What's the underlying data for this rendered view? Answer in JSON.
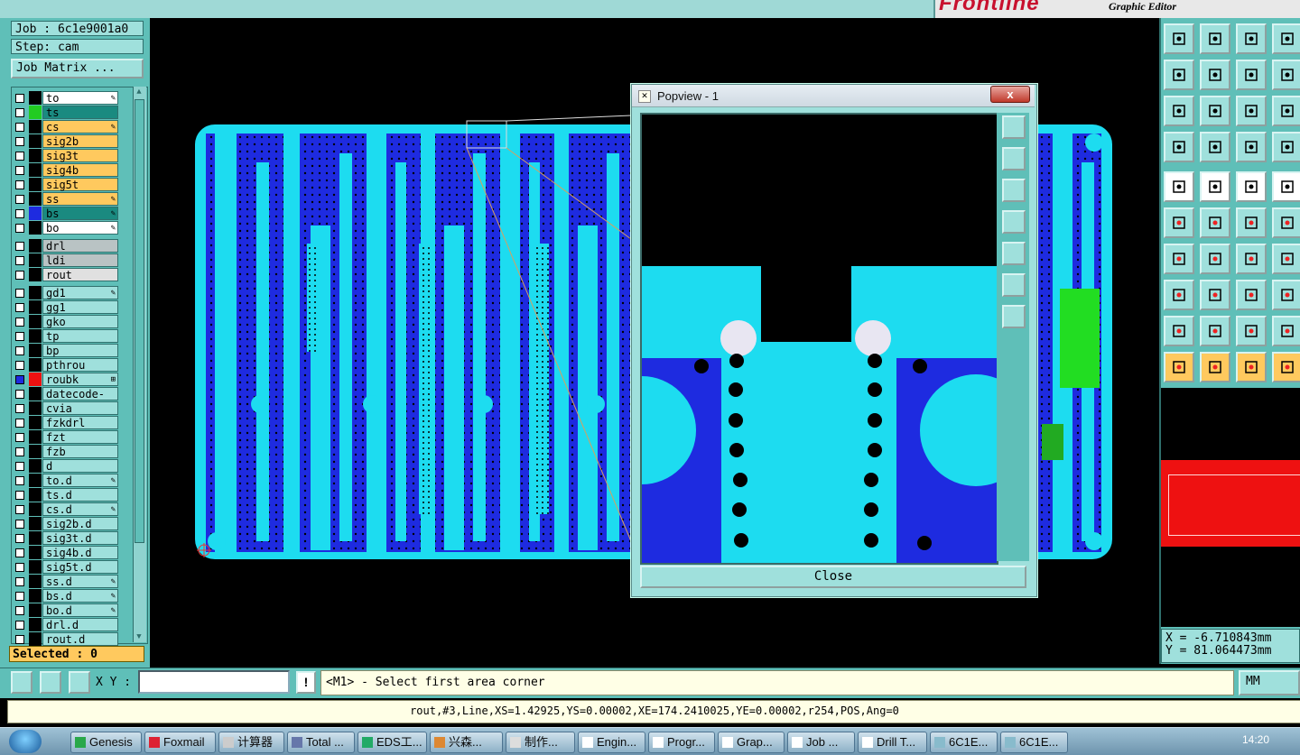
{
  "header": {
    "brand": "Frontline",
    "subtitle": "Graphic Editor"
  },
  "job": {
    "job_label": "Job : 6c1e9001a0",
    "step_label": "Step: cam",
    "job_matrix_button": "Job Matrix ..."
  },
  "layers": [
    {
      "name": "to",
      "color": "#000000",
      "fill": "#ffffff",
      "mark": "✎"
    },
    {
      "name": "ts",
      "color": "#22cc22",
      "fill": "#1a8a80",
      "mark": ""
    },
    {
      "name": "cs",
      "color": "#000000",
      "fill": "#ffc95e",
      "mark": "✎"
    },
    {
      "name": "sig2b",
      "color": "#000000",
      "fill": "#ffc95e",
      "mark": ""
    },
    {
      "name": "sig3t",
      "color": "#000000",
      "fill": "#ffc95e",
      "mark": ""
    },
    {
      "name": "sig4b",
      "color": "#000000",
      "fill": "#ffc95e",
      "mark": ""
    },
    {
      "name": "sig5t",
      "color": "#000000",
      "fill": "#ffc95e",
      "mark": ""
    },
    {
      "name": "ss",
      "color": "#000000",
      "fill": "#ffc95e",
      "mark": "✎"
    },
    {
      "name": "bs",
      "color": "#1e2be0",
      "fill": "#1a8a80",
      "mark": "✎"
    },
    {
      "name": "bo",
      "color": "#000000",
      "fill": "#ffffff",
      "mark": "✎"
    },
    {
      "name": "drl",
      "color": "#000000",
      "fill": "#b9c3c4",
      "mark": ""
    },
    {
      "name": "ldi",
      "color": "#000000",
      "fill": "#b9c3c4",
      "mark": ""
    },
    {
      "name": "rout",
      "color": "#000000",
      "fill": "#e0e0e0",
      "mark": ""
    },
    {
      "name": "gd1",
      "color": "#000000",
      "fill": "#9fe0dc",
      "mark": "✎"
    },
    {
      "name": "gg1",
      "color": "#000000",
      "fill": "#9fe0dc",
      "mark": ""
    },
    {
      "name": "gko",
      "color": "#000000",
      "fill": "#9fe0dc",
      "mark": ""
    },
    {
      "name": "tp",
      "color": "#000000",
      "fill": "#9fe0dc",
      "mark": ""
    },
    {
      "name": "bp",
      "color": "#000000",
      "fill": "#9fe0dc",
      "mark": ""
    },
    {
      "name": "pthrou",
      "color": "#000000",
      "fill": "#9fe0dc",
      "mark": ""
    },
    {
      "name": "roubk",
      "color": "#ee1111",
      "fill": "#9fe0dc",
      "mark": "⊞"
    },
    {
      "name": "datecode-to",
      "color": "#000000",
      "fill": "#9fe0dc",
      "mark": ""
    },
    {
      "name": "cvia",
      "color": "#000000",
      "fill": "#9fe0dc",
      "mark": ""
    },
    {
      "name": "fzkdrl",
      "color": "#000000",
      "fill": "#9fe0dc",
      "mark": ""
    },
    {
      "name": "fzt",
      "color": "#000000",
      "fill": "#9fe0dc",
      "mark": ""
    },
    {
      "name": "fzb",
      "color": "#000000",
      "fill": "#9fe0dc",
      "mark": ""
    },
    {
      "name": "d",
      "color": "#000000",
      "fill": "#9fe0dc",
      "mark": ""
    },
    {
      "name": "to.d",
      "color": "#000000",
      "fill": "#9fe0dc",
      "mark": "✎"
    },
    {
      "name": "ts.d",
      "color": "#000000",
      "fill": "#9fe0dc",
      "mark": ""
    },
    {
      "name": "cs.d",
      "color": "#000000",
      "fill": "#9fe0dc",
      "mark": "✎"
    },
    {
      "name": "sig2b.d",
      "color": "#000000",
      "fill": "#9fe0dc",
      "mark": ""
    },
    {
      "name": "sig3t.d",
      "color": "#000000",
      "fill": "#9fe0dc",
      "mark": ""
    },
    {
      "name": "sig4b.d",
      "color": "#000000",
      "fill": "#9fe0dc",
      "mark": ""
    },
    {
      "name": "sig5t.d",
      "color": "#000000",
      "fill": "#9fe0dc",
      "mark": ""
    },
    {
      "name": "ss.d",
      "color": "#000000",
      "fill": "#9fe0dc",
      "mark": "✎"
    },
    {
      "name": "bs.d",
      "color": "#000000",
      "fill": "#9fe0dc",
      "mark": "✎"
    },
    {
      "name": "bo.d",
      "color": "#000000",
      "fill": "#9fe0dc",
      "mark": "✎"
    },
    {
      "name": "drl.d",
      "color": "#000000",
      "fill": "#9fe0dc",
      "mark": ""
    },
    {
      "name": "rout.d",
      "color": "#000000",
      "fill": "#9fe0dc",
      "mark": ""
    }
  ],
  "selected": "Selected : 0",
  "popview": {
    "title": "Popview - 1",
    "close_x": "x",
    "close_button": "Close"
  },
  "coords": {
    "x": "X = -6.710843mm",
    "y": "Y = 81.064473mm"
  },
  "command": {
    "xy_label": "X Y :",
    "xy_value": "",
    "excl": "!",
    "prompt": "<M1> - Select first area corner",
    "units": "MM"
  },
  "status": "rout,#3,Line,XS=1.42925,YS=0.00002,XE=174.2410025,YE=0.00002,r254,POS,Ang=0",
  "taskbar": {
    "items": [
      "Genesis",
      "Foxmail",
      "计算器",
      "Total ...",
      "EDS工...",
      "兴森...",
      "制作...",
      "Engin...",
      "Progr...",
      "Grap...",
      "Job ...",
      "Drill T...",
      "6C1E...",
      "6C1E..."
    ],
    "clock": "14:20"
  },
  "colors": {
    "panel": "#5fbfb8",
    "copper_light": "#1ddcf0",
    "copper_dark": "#1e2be0"
  }
}
